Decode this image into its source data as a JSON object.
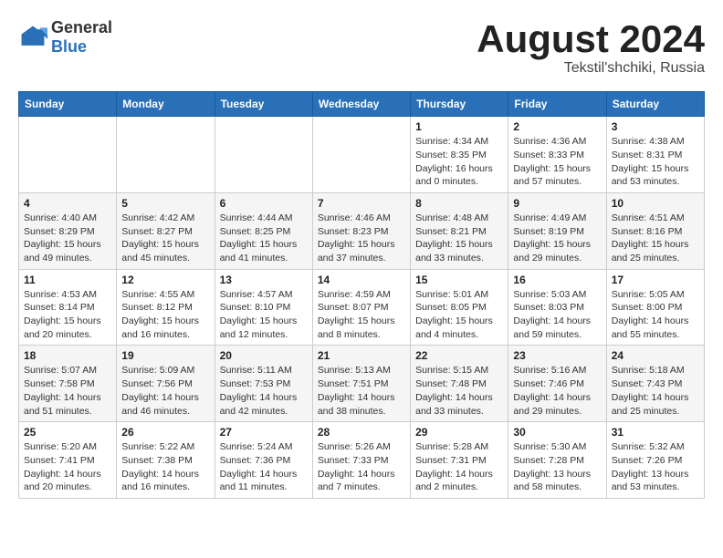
{
  "header": {
    "logo": {
      "general": "General",
      "blue": "Blue"
    },
    "month": "August 2024",
    "location": "Tekstil'shchiki, Russia"
  },
  "days_of_week": [
    "Sunday",
    "Monday",
    "Tuesday",
    "Wednesday",
    "Thursday",
    "Friday",
    "Saturday"
  ],
  "weeks": [
    [
      {
        "day": "",
        "info": ""
      },
      {
        "day": "",
        "info": ""
      },
      {
        "day": "",
        "info": ""
      },
      {
        "day": "",
        "info": ""
      },
      {
        "day": "1",
        "info": "Sunrise: 4:34 AM\nSunset: 8:35 PM\nDaylight: 16 hours\nand 0 minutes."
      },
      {
        "day": "2",
        "info": "Sunrise: 4:36 AM\nSunset: 8:33 PM\nDaylight: 15 hours\nand 57 minutes."
      },
      {
        "day": "3",
        "info": "Sunrise: 4:38 AM\nSunset: 8:31 PM\nDaylight: 15 hours\nand 53 minutes."
      }
    ],
    [
      {
        "day": "4",
        "info": "Sunrise: 4:40 AM\nSunset: 8:29 PM\nDaylight: 15 hours\nand 49 minutes."
      },
      {
        "day": "5",
        "info": "Sunrise: 4:42 AM\nSunset: 8:27 PM\nDaylight: 15 hours\nand 45 minutes."
      },
      {
        "day": "6",
        "info": "Sunrise: 4:44 AM\nSunset: 8:25 PM\nDaylight: 15 hours\nand 41 minutes."
      },
      {
        "day": "7",
        "info": "Sunrise: 4:46 AM\nSunset: 8:23 PM\nDaylight: 15 hours\nand 37 minutes."
      },
      {
        "day": "8",
        "info": "Sunrise: 4:48 AM\nSunset: 8:21 PM\nDaylight: 15 hours\nand 33 minutes."
      },
      {
        "day": "9",
        "info": "Sunrise: 4:49 AM\nSunset: 8:19 PM\nDaylight: 15 hours\nand 29 minutes."
      },
      {
        "day": "10",
        "info": "Sunrise: 4:51 AM\nSunset: 8:16 PM\nDaylight: 15 hours\nand 25 minutes."
      }
    ],
    [
      {
        "day": "11",
        "info": "Sunrise: 4:53 AM\nSunset: 8:14 PM\nDaylight: 15 hours\nand 20 minutes."
      },
      {
        "day": "12",
        "info": "Sunrise: 4:55 AM\nSunset: 8:12 PM\nDaylight: 15 hours\nand 16 minutes."
      },
      {
        "day": "13",
        "info": "Sunrise: 4:57 AM\nSunset: 8:10 PM\nDaylight: 15 hours\nand 12 minutes."
      },
      {
        "day": "14",
        "info": "Sunrise: 4:59 AM\nSunset: 8:07 PM\nDaylight: 15 hours\nand 8 minutes."
      },
      {
        "day": "15",
        "info": "Sunrise: 5:01 AM\nSunset: 8:05 PM\nDaylight: 15 hours\nand 4 minutes."
      },
      {
        "day": "16",
        "info": "Sunrise: 5:03 AM\nSunset: 8:03 PM\nDaylight: 14 hours\nand 59 minutes."
      },
      {
        "day": "17",
        "info": "Sunrise: 5:05 AM\nSunset: 8:00 PM\nDaylight: 14 hours\nand 55 minutes."
      }
    ],
    [
      {
        "day": "18",
        "info": "Sunrise: 5:07 AM\nSunset: 7:58 PM\nDaylight: 14 hours\nand 51 minutes."
      },
      {
        "day": "19",
        "info": "Sunrise: 5:09 AM\nSunset: 7:56 PM\nDaylight: 14 hours\nand 46 minutes."
      },
      {
        "day": "20",
        "info": "Sunrise: 5:11 AM\nSunset: 7:53 PM\nDaylight: 14 hours\nand 42 minutes."
      },
      {
        "day": "21",
        "info": "Sunrise: 5:13 AM\nSunset: 7:51 PM\nDaylight: 14 hours\nand 38 minutes."
      },
      {
        "day": "22",
        "info": "Sunrise: 5:15 AM\nSunset: 7:48 PM\nDaylight: 14 hours\nand 33 minutes."
      },
      {
        "day": "23",
        "info": "Sunrise: 5:16 AM\nSunset: 7:46 PM\nDaylight: 14 hours\nand 29 minutes."
      },
      {
        "day": "24",
        "info": "Sunrise: 5:18 AM\nSunset: 7:43 PM\nDaylight: 14 hours\nand 25 minutes."
      }
    ],
    [
      {
        "day": "25",
        "info": "Sunrise: 5:20 AM\nSunset: 7:41 PM\nDaylight: 14 hours\nand 20 minutes."
      },
      {
        "day": "26",
        "info": "Sunrise: 5:22 AM\nSunset: 7:38 PM\nDaylight: 14 hours\nand 16 minutes."
      },
      {
        "day": "27",
        "info": "Sunrise: 5:24 AM\nSunset: 7:36 PM\nDaylight: 14 hours\nand 11 minutes."
      },
      {
        "day": "28",
        "info": "Sunrise: 5:26 AM\nSunset: 7:33 PM\nDaylight: 14 hours\nand 7 minutes."
      },
      {
        "day": "29",
        "info": "Sunrise: 5:28 AM\nSunset: 7:31 PM\nDaylight: 14 hours\nand 2 minutes."
      },
      {
        "day": "30",
        "info": "Sunrise: 5:30 AM\nSunset: 7:28 PM\nDaylight: 13 hours\nand 58 minutes."
      },
      {
        "day": "31",
        "info": "Sunrise: 5:32 AM\nSunset: 7:26 PM\nDaylight: 13 hours\nand 53 minutes."
      }
    ]
  ]
}
